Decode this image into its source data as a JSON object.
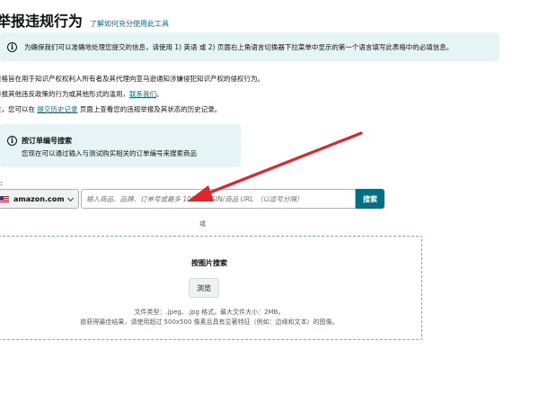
{
  "header": {
    "title": "举报违规行为",
    "help_link": "了解如何充分使用此工具"
  },
  "language_notice": {
    "icon": "info-icon",
    "text": "为确保我们可以准确地处理您提交的信息，请使用 1) 英语 或 2) 页面右上角语言切换器下拉菜单中显示的第一个语言填写此表格中的必填信息。"
  },
  "intro": {
    "line1": "表格旨在用于知识产权权利人所有者及其代理向亚马逊通知涉嫌侵犯知识产权的侵权行为。",
    "line2_prefix": "举报其他违反政策的行为或其他形式的滥用，",
    "line2_link": "联系我们",
    "line2_suffix": "。",
    "line3_prefix": "注，您可以在 ",
    "line3_link": "提交历史记录",
    "line3_suffix": " 页面上查看您的违规举报及其状态的历史记录。"
  },
  "order_search_notice": {
    "icon": "info-icon",
    "title": "按订单编号搜索",
    "description": "您现在可以通过输入与测试购买相关的订单编号来搜索商品"
  },
  "search": {
    "label": "索:",
    "marketplace": "amazon.com",
    "marketplace_flag": "us-flag-icon",
    "placeholder": "输入商品、品牌、订单号或最多 100 个 ASIN/商品 URL （以逗号分隔）",
    "button": "搜索"
  },
  "divider": "或",
  "image_search": {
    "title": "按图片搜索",
    "browse_button": "浏览",
    "hint_file": "文件类型：.jpeg、.jpg 格式。最大文件大小：2MB。",
    "hint_quality": "欲获得最佳结果，请使用超过 500x500 像素且具有显著特征（例如：边缘和文本）的图像。"
  },
  "annotation": {
    "arrow_color": "#e3242b"
  },
  "colors": {
    "accent": "#007185",
    "banner_bg": "#e7f4f5",
    "link": "#007185"
  }
}
